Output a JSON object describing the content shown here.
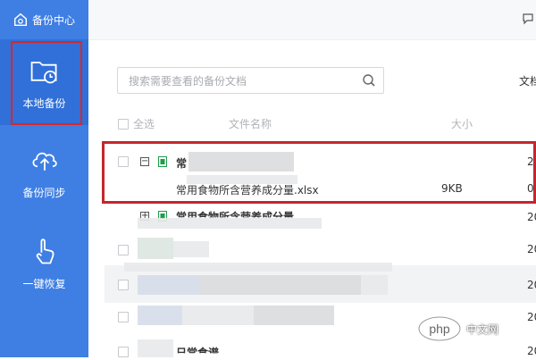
{
  "sidebar": {
    "header_label": "备份中心",
    "items": [
      {
        "label": "本地备份",
        "icon": "folder-clock-icon",
        "active": true
      },
      {
        "label": "备份同步",
        "icon": "cloud-upload-icon",
        "active": false
      },
      {
        "label": "一键恢复",
        "icon": "hand-tap-icon",
        "active": false
      }
    ]
  },
  "search": {
    "placeholder": "搜索需要查看的备份文档"
  },
  "toolbar": {
    "right_label_cut": "文档"
  },
  "table": {
    "headers": {
      "select_all": "全选",
      "name": "文件名称",
      "size": "大小"
    },
    "groups": [
      {
        "name": "常",
        "date_cut": "2",
        "children": [
          {
            "name": "常用食物所含营养成分量.xlsx",
            "size": "9KB",
            "date_cut": "0"
          }
        ]
      },
      {
        "name": "常用食物所含营养成分量",
        "date_cut": "20"
      }
    ],
    "obscured_dates": [
      "20",
      "20",
      "20",
      "20"
    ],
    "last_row_cut": "日常食谱"
  },
  "watermark": {
    "brand": "php",
    "site": "中文网"
  },
  "colors": {
    "sidebar": "#3f7fe3",
    "highlight": "#c4262d",
    "excel_green": "#1e9e4a"
  }
}
